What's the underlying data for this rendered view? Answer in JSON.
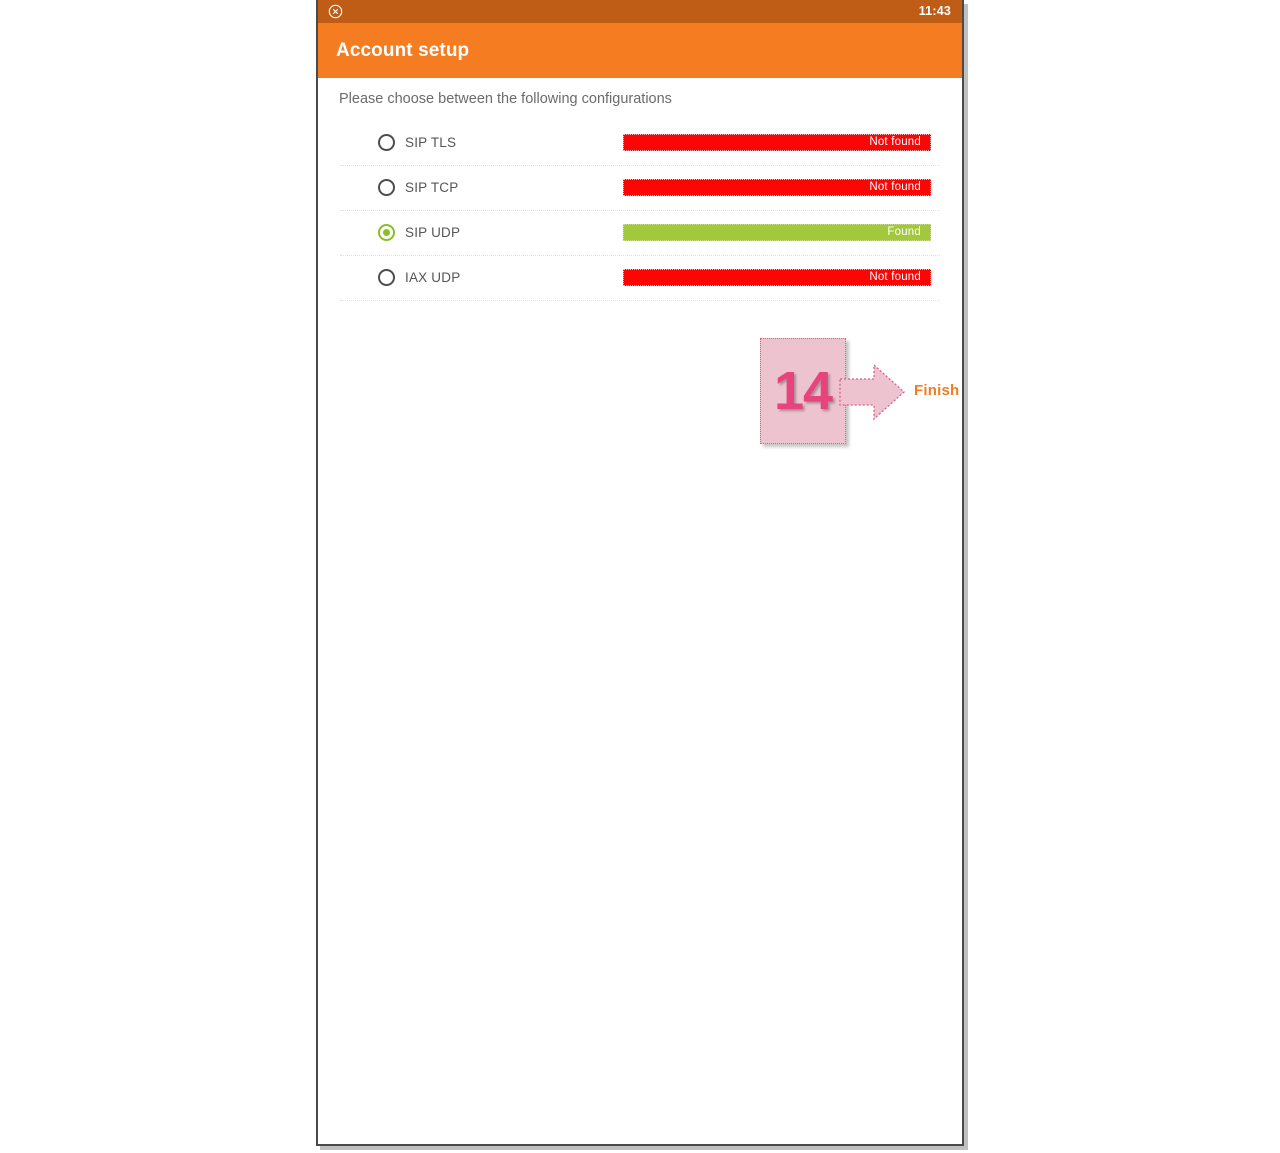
{
  "window": {
    "status_bar": {
      "close_icon": "close-circle-icon",
      "time": "11:43",
      "background": "#bf5c16"
    },
    "app_bar": {
      "title": "Account setup",
      "background": "#f57c20"
    }
  },
  "main": {
    "subtitle": "Please choose between the following configurations",
    "options": [
      {
        "label": "SIP TLS",
        "selected": false,
        "status": "Not found",
        "status_state": "notfound",
        "status_color": "#fb0505"
      },
      {
        "label": "SIP TCP",
        "selected": false,
        "status": "Not found",
        "status_state": "notfound",
        "status_color": "#fb0505"
      },
      {
        "label": "SIP UDP",
        "selected": true,
        "status": "Found",
        "status_state": "found",
        "status_color": "#a2c93c"
      },
      {
        "label": "IAX UDP",
        "selected": false,
        "status": "Not found",
        "status_state": "notfound",
        "status_color": "#fb0505"
      }
    ]
  },
  "annotation": {
    "step_number": "14",
    "action_label": "Finish",
    "box_color": "#edc3d0",
    "accent_color": "#e8437c",
    "label_color": "#f47c20"
  }
}
